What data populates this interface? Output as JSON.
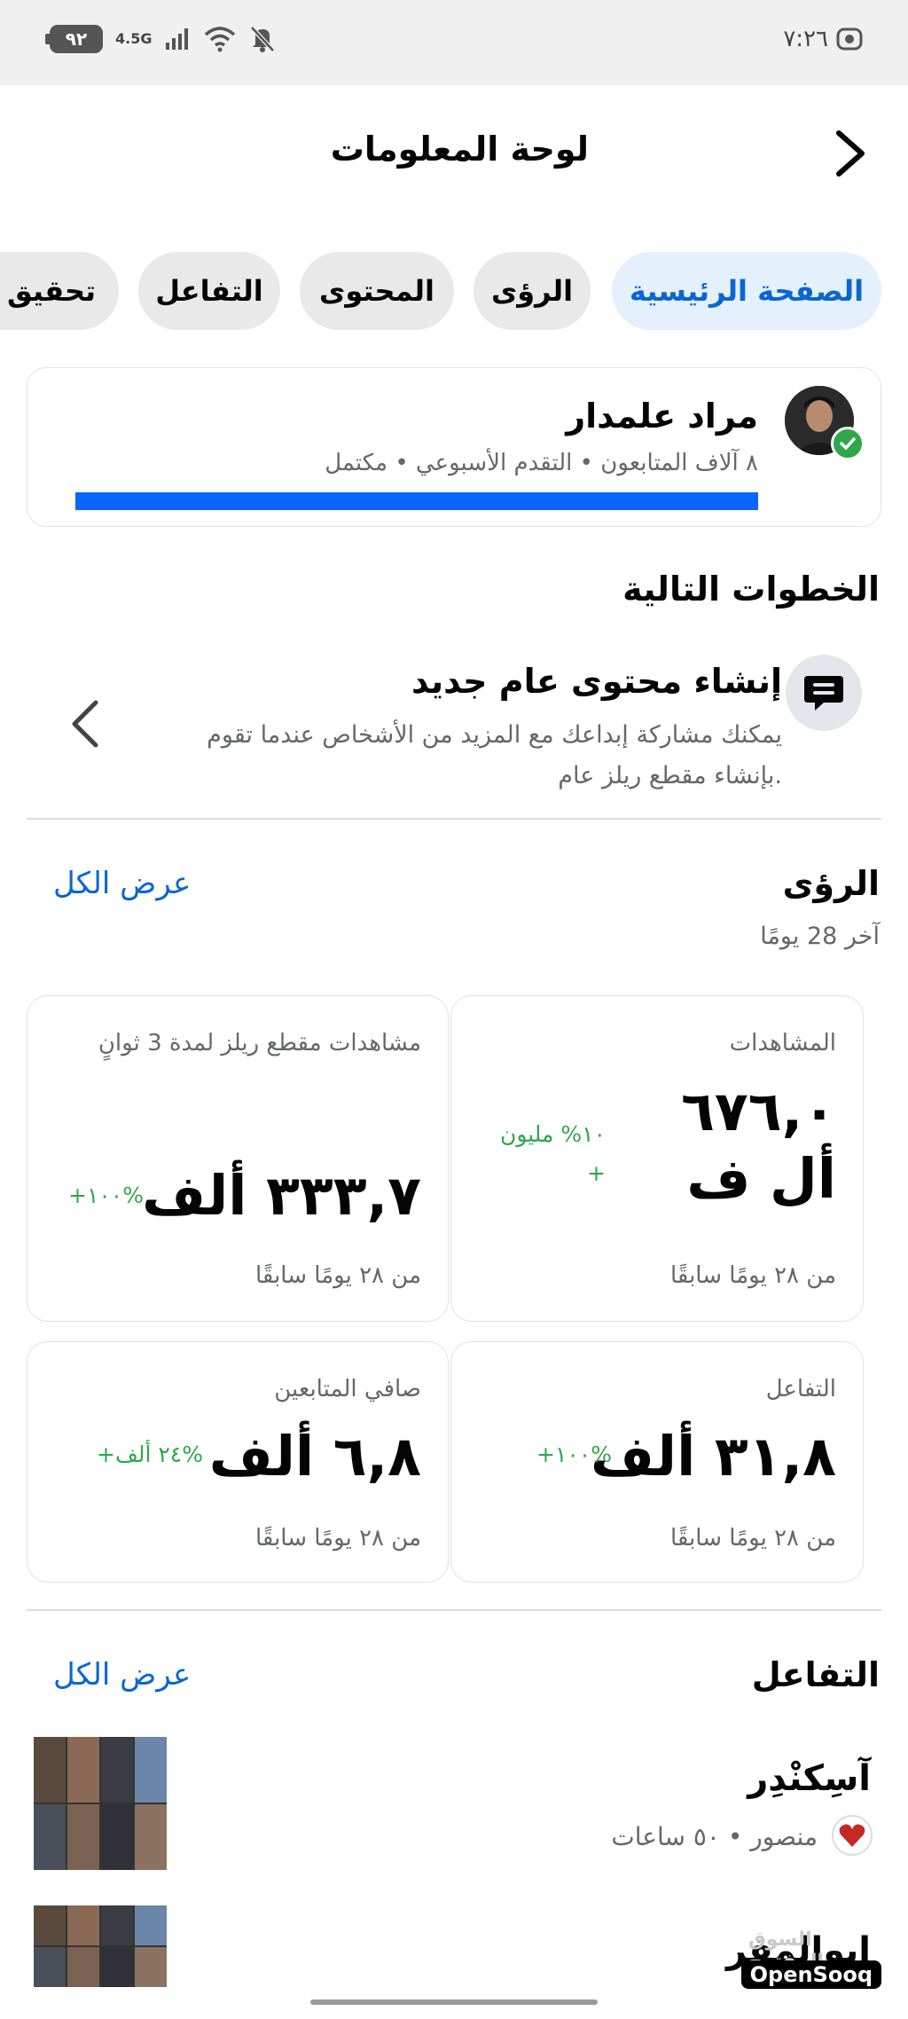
{
  "status_bar": {
    "battery": "٩٢",
    "network": "4.5G",
    "time": "٧:٢٦"
  },
  "header": {
    "title": "لوحة المعلومات"
  },
  "tabs": [
    {
      "label": "الصفحة الرئيسية",
      "active": true
    },
    {
      "label": "الرؤى",
      "active": false
    },
    {
      "label": "المحتوى",
      "active": false
    },
    {
      "label": "التفاعل",
      "active": false
    },
    {
      "label": "تحقيق ا",
      "active": false
    }
  ],
  "profile": {
    "name": "مراد علمدار",
    "subtitle": "٨ آلاف المتابعون • التقدم الأسبوعي • مكتمل",
    "progress": 1.0
  },
  "next_steps": {
    "title": "الخطوات التالية",
    "item_title": "إنشاء محتوى عام جديد",
    "item_desc": "يمكنك مشاركة إبداعك مع المزيد من الأشخاص عندما تقوم بإنشاء مقطع ريلز عام."
  },
  "insights": {
    "title": "الرؤى",
    "see_all": "عرض الكل",
    "period": "آخر 28 يومًا",
    "metrics": [
      {
        "label": "المشاهدات",
        "value": "٦٧٦,٠ أل ف",
        "delta": "١٠% مليون +",
        "foot": "من ٢٨ يومًا سابقًا"
      },
      {
        "label": "مشاهدات مقطع ريلز لمدة 3 ثوانٍ",
        "value": "٣٣٣,٧ ألف",
        "delta": "+١٠٠%",
        "foot": "من ٢٨ يومًا سابقًا"
      },
      {
        "label": "التفاعل",
        "value": "٣١,٨ ألف",
        "delta": "+١٠٠%",
        "foot": "من ٢٨ يومًا سابقًا"
      },
      {
        "label": "صافي المتابعين",
        "value": "٦,٨ ألف",
        "delta": "+٢٤ ألف%",
        "foot": "من ٢٨ يومًا سابقًا"
      }
    ]
  },
  "engagement": {
    "title": "التفاعل",
    "see_all": "عرض الكل",
    "posts": [
      {
        "title": "آسِكنْدِر",
        "meta": "منصور • ٥٠ ساعات"
      },
      {
        "title": "ابوالمقر"
      }
    ]
  },
  "watermark": {
    "text": "السوق المفتوح",
    "brand": "OpenSooq"
  },
  "colors": {
    "accent": "#0866ff",
    "link": "#0a66d1",
    "positive": "#2ea84a",
    "secondary_text": "#65676b"
  }
}
